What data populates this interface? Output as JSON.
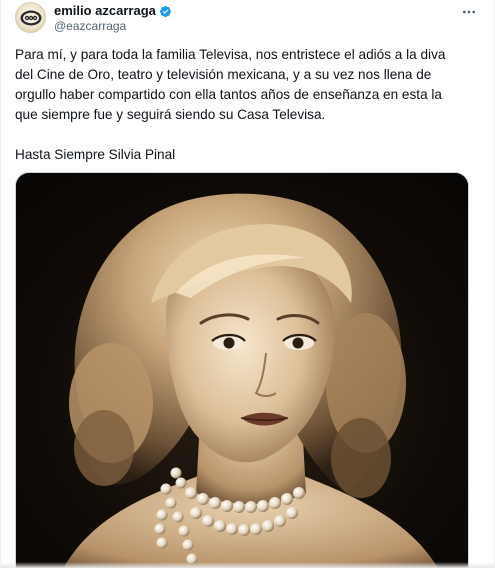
{
  "author": {
    "display_name": "emilio azcarraga",
    "handle": "@eazcarraga",
    "verified": true,
    "avatar_icon": "televisa-logo-icon"
  },
  "tweet": {
    "paragraph_1": "Para mí, y para toda la familia Televisa, nos entristece el adiós a la diva del Cine de Oro, teatro y televisión mexicana, y a su vez nos llena de orgullo haber compartido con ella tantos años de enseñanza en esta la que siempre fue y seguirá siendo su Casa Televisa.",
    "paragraph_2": "Hasta Siempre Silvia Pinal"
  },
  "media": {
    "type": "photo",
    "description_icon": "portrait-photo-icon"
  },
  "colors": {
    "text": "#0f1419",
    "secondary_text": "#536471",
    "verified_blue": "#1d9bf0",
    "border": "#cfd9de"
  }
}
